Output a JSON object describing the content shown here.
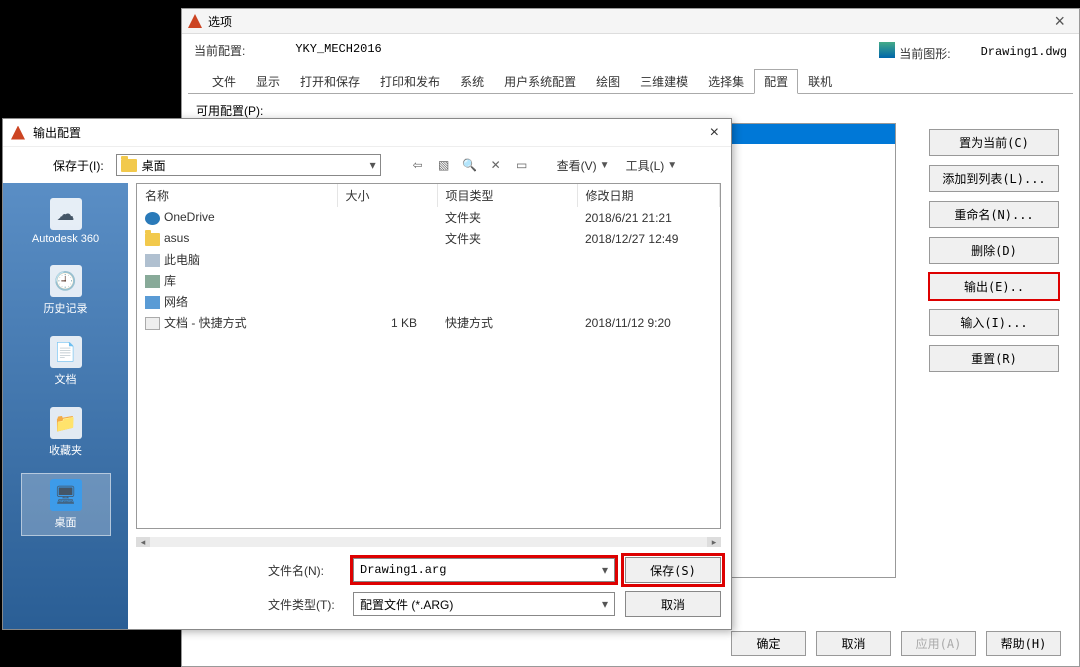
{
  "options": {
    "title": "选项",
    "closeX": "×",
    "currentProfileLabel": "当前配置:",
    "currentProfile": "YKY_MECH2016",
    "currentDrawingLabel": "当前图形:",
    "currentDrawing": "Drawing1.dwg",
    "tabs": [
      "文件",
      "显示",
      "打开和保存",
      "打印和发布",
      "系统",
      "用户系统配置",
      "绘图",
      "三维建模",
      "选择集",
      "配置",
      "联机"
    ],
    "activeTab": 9,
    "availableLabel": "可用配置(P):",
    "buttons": {
      "setCurrent": "置为当前(C)",
      "addToList": "添加到列表(L)...",
      "rename": "重命名(N)...",
      "delete": "删除(D)",
      "export": "输出(E)..",
      "import": "输入(I)...",
      "reset": "重置(R)"
    },
    "footer": {
      "ok": "确定",
      "cancel": "取消",
      "apply": "应用(A)",
      "help": "帮助(H)"
    }
  },
  "save": {
    "title": "输出配置",
    "closeX": "×",
    "saveInLabel": "保存于(I):",
    "saveInValue": "桌面",
    "viewBtn": "查看(V)",
    "toolsBtn": "工具(L)",
    "sidebar": [
      {
        "label": "Autodesk 360"
      },
      {
        "label": "历史记录"
      },
      {
        "label": "文档"
      },
      {
        "label": "收藏夹"
      },
      {
        "label": "桌面"
      }
    ],
    "columns": {
      "name": "名称",
      "size": "大小",
      "type": "项目类型",
      "date": "修改日期"
    },
    "rows": [
      {
        "icon": "cloud",
        "name": "OneDrive",
        "size": "",
        "type": "文件夹",
        "date": "2018/6/21 21:21"
      },
      {
        "icon": "folder",
        "name": "asus",
        "size": "",
        "type": "文件夹",
        "date": "2018/12/27 12:49"
      },
      {
        "icon": "pc",
        "name": "此电脑",
        "size": "",
        "type": "",
        "date": ""
      },
      {
        "icon": "lib",
        "name": "库",
        "size": "",
        "type": "",
        "date": ""
      },
      {
        "icon": "net",
        "name": "网络",
        "size": "",
        "type": "",
        "date": ""
      },
      {
        "icon": "link",
        "name": "文档 - 快捷方式",
        "size": "1 KB",
        "type": "快捷方式",
        "date": "2018/11/12 9:20"
      }
    ],
    "fileNameLabel": "文件名(N):",
    "fileName": "Drawing1.arg",
    "fileTypeLabel": "文件类型(T):",
    "fileType": "配置文件 (*.ARG)",
    "saveBtn": "保存(S)",
    "cancelBtn": "取消"
  }
}
